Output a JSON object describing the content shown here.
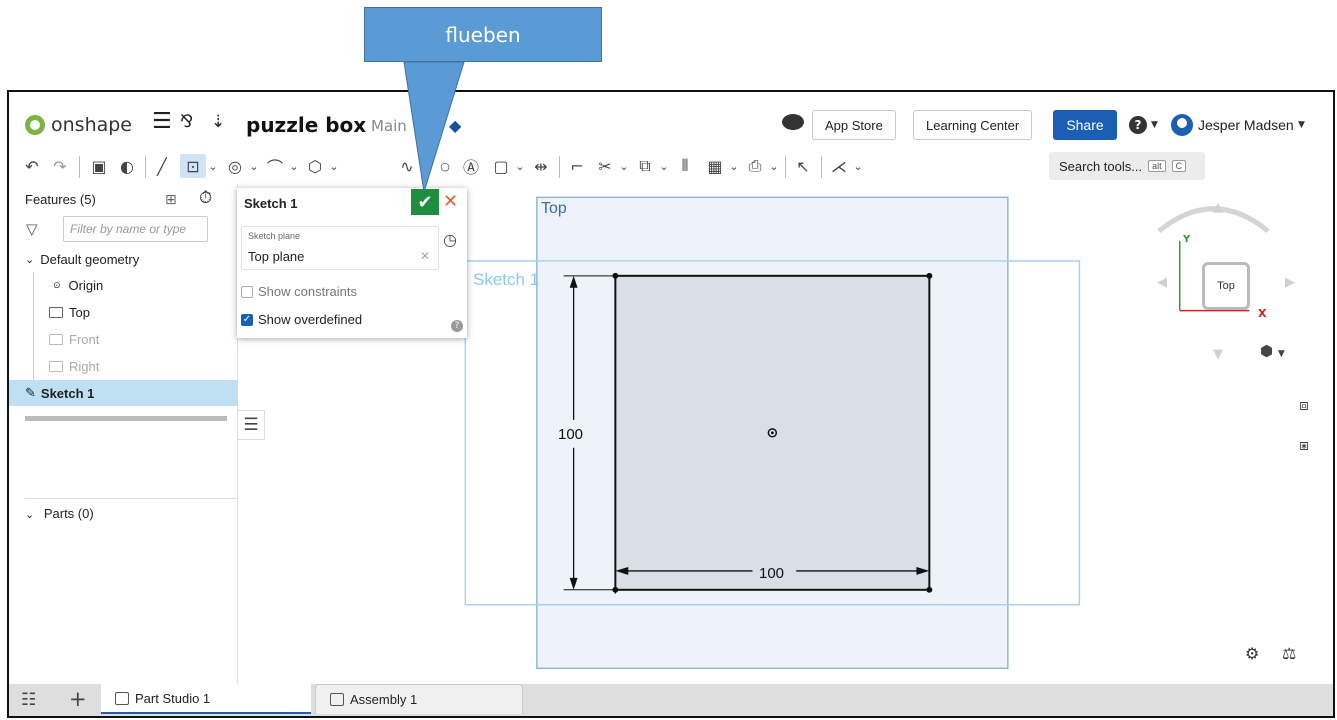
{
  "callout": {
    "text": "flueben"
  },
  "header": {
    "logo_text": "onshape",
    "doc_title": "puzzle box",
    "branch": "Main",
    "app_store": "App Store",
    "learning_center": "Learning Center",
    "share": "Share",
    "user_name": "Jesper Madsen"
  },
  "toolbar": {
    "search_label": "Search tools...",
    "shortcut_alt": "alt",
    "shortcut_key": "C"
  },
  "features": {
    "title": "Features (5)",
    "filter_placeholder": "Filter by name or type",
    "default_geometry": "Default geometry",
    "items": [
      {
        "label": "Origin"
      },
      {
        "label": "Top"
      },
      {
        "label": "Front"
      },
      {
        "label": "Right"
      },
      {
        "label": "Sketch 1"
      }
    ],
    "parts": "Parts (0)"
  },
  "sketch_dialog": {
    "title": "Sketch 1",
    "plane_label": "Sketch plane",
    "plane_value": "Top plane",
    "show_constraints": "Show constraints",
    "show_constraints_checked": false,
    "show_overdefined": "Show overdefined",
    "show_overdefined_checked": true
  },
  "viewport": {
    "plane_top_label": "Top",
    "sketch_label": "Sketch 1",
    "dim_vertical": "100",
    "dim_horizontal": "100",
    "view_cube_face": "Top",
    "axis_y": "Y",
    "axis_x": "X"
  },
  "tabs": [
    {
      "label": "Part Studio 1",
      "active": true
    },
    {
      "label": "Assembly 1",
      "active": false
    }
  ],
  "colors": {
    "accent_blue": "#1a5fb4",
    "accept_green": "#1e8e3e",
    "cancel_orange": "#e06030",
    "plane_blue": "#8fb8d8",
    "callout_blue": "#5b9bd5"
  }
}
